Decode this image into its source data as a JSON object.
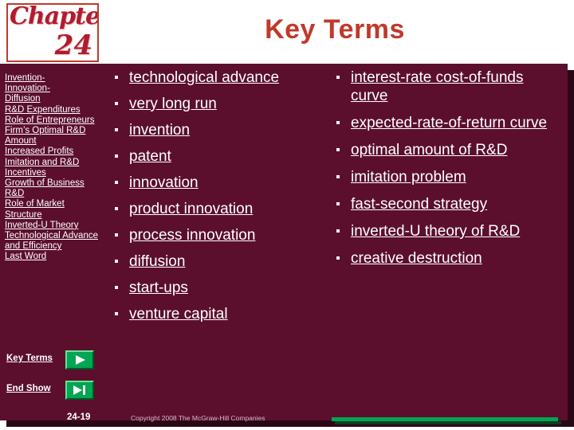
{
  "logo": {
    "word": "Chapter",
    "number": "24"
  },
  "title": "Key Terms",
  "sidebar": {
    "items": [
      "Invention-",
      "Innovation-",
      "Diffusion",
      "R&D Expenditures",
      "Role of Entrepreneurs",
      "Firm’s Optimal R&D Amount",
      "Increased Profits",
      "Imitation and R&D Incentives",
      "Growth of Business R&D",
      "Role of Market Structure",
      "Inverted-U Theory",
      "Technological Advance and Efficiency",
      "Last Word"
    ],
    "nav": {
      "key_terms_label": "Key Terms",
      "key_terms_icon": "play-triangle-icon",
      "end_show_label": "End Show",
      "end_show_icon": "end-show-icon"
    }
  },
  "columns": {
    "left": [
      "technological advance",
      "very long run",
      "invention",
      "patent",
      "innovation",
      "product innovation",
      "process innovation",
      "diffusion",
      "start-ups",
      "venture capital"
    ],
    "right": [
      "interest-rate cost-of-funds curve",
      "expected-rate-of-return curve",
      "optimal amount of R&D",
      "imitation problem",
      "fast-second strategy",
      "inverted-U theory of R&D",
      "creative destruction"
    ]
  },
  "footer": {
    "slide_number": "24-19",
    "copyright": "Copyright 2008 The McGraw-Hill Companies"
  },
  "colors": {
    "panel": "#5b0f2d",
    "title": "#c0392b",
    "accent_green": "#00a651",
    "text": "#ffffff"
  }
}
